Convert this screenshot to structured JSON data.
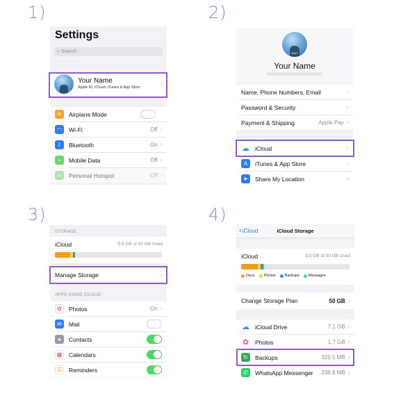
{
  "steps": [
    "1)",
    "2)",
    "3)",
    "4)"
  ],
  "p1": {
    "title": "Settings",
    "search_placeholder": "Search",
    "profile": {
      "name": "Your Name",
      "subtitle": "Apple ID, iCloud, iTunes & App Store"
    },
    "rows": [
      {
        "label": "Airplane Mode",
        "value": "",
        "icon": "airplane-icon",
        "color": "#f7a334"
      },
      {
        "label": "Wi-Fi",
        "value": "Off",
        "icon": "wifi-icon",
        "color": "#2f7bf5"
      },
      {
        "label": "Bluetooth",
        "value": "On",
        "icon": "bluetooth-icon",
        "color": "#2f7bf5"
      },
      {
        "label": "Mobile Data",
        "value": "Off",
        "icon": "antenna-icon",
        "color": "#6fd36c"
      },
      {
        "label": "Personal Hotspot",
        "value": "Off",
        "icon": "hotspot-icon",
        "color": "#7fd67b"
      }
    ]
  },
  "p2": {
    "avatar_badge": "EDIT",
    "name": "Your Name",
    "rows1": [
      {
        "label": "Name, Phone Numbers, Email",
        "value": ""
      },
      {
        "label": "Password & Security",
        "value": ""
      },
      {
        "label": "Payment & Shipping",
        "value": "Apple Pay"
      }
    ],
    "rows2": [
      {
        "label": "iCloud",
        "icon": "cloud-icon",
        "color": "#ffffff"
      },
      {
        "label": "iTunes & App Store",
        "icon": "app-store-icon",
        "color": "#2f7bf5"
      },
      {
        "label": "Share My Location",
        "icon": "location-arrow-icon",
        "color": "#2f7bf5"
      }
    ]
  },
  "p3": {
    "storage_caption": "STORAGE",
    "icloud_label": "iCloud",
    "icloud_usage": "9,5 GB of 50 GB Used",
    "manage_storage": "Manage Storage",
    "apps_caption": "APPS USING ICLOUD",
    "apps": [
      {
        "label": "Photos",
        "value": "On",
        "icon": "photos-icon",
        "toggle": ""
      },
      {
        "label": "Mail",
        "value": "",
        "icon": "mail-icon",
        "toggle": "off"
      },
      {
        "label": "Contacts",
        "value": "",
        "icon": "contacts-icon",
        "toggle": "on"
      },
      {
        "label": "Calendars",
        "value": "",
        "icon": "calendar-icon",
        "toggle": "on"
      },
      {
        "label": "Reminders",
        "value": "",
        "icon": "reminders-icon",
        "toggle": "on"
      }
    ],
    "colors": {
      "docs": "#f59a23",
      "photos": "#f7d63d",
      "backups": "#3a8ee6"
    }
  },
  "p4": {
    "back_label": "iCloud",
    "nav_title": "iCloud Storage",
    "icloud_label": "iCloud",
    "icloud_usage": "9,5 GB of 50 GB Used",
    "legend": [
      {
        "label": "Docs",
        "color": "#f59a23"
      },
      {
        "label": "Photos",
        "color": "#f7d63d"
      },
      {
        "label": "Backups",
        "color": "#3a8ee6"
      },
      {
        "label": "Messages",
        "color": "#4cd964"
      }
    ],
    "plan_label": "Change Storage Plan",
    "plan_value": "50 GB",
    "items": [
      {
        "label": "iCloud Drive",
        "value": "7.1 GB",
        "icon": "cloud-icon"
      },
      {
        "label": "Photos",
        "value": "1.7 GB",
        "icon": "photos-icon"
      },
      {
        "label": "Backups",
        "value": "329.5 MB",
        "icon": "backup-icon"
      },
      {
        "label": "WhatsApp Messenger",
        "value": "238.8 MB",
        "icon": "whatsapp-icon"
      }
    ]
  }
}
